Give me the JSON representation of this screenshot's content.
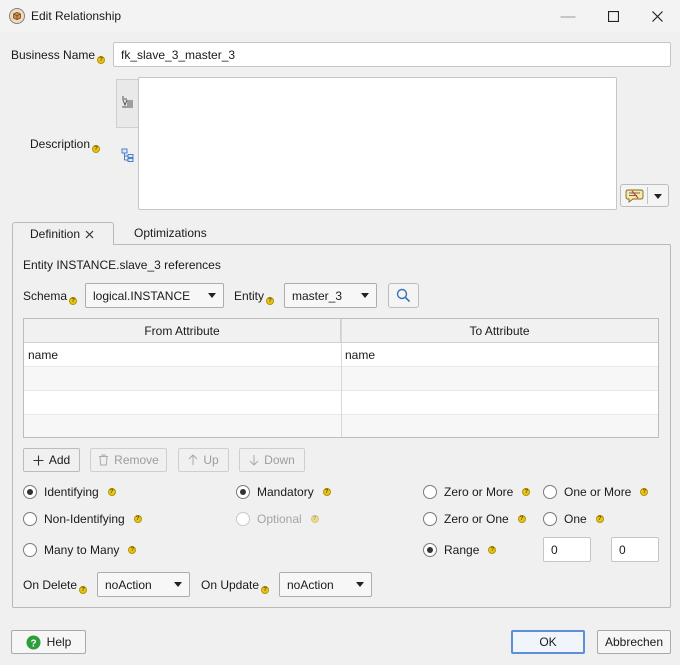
{
  "window": {
    "title": "Edit Relationship"
  },
  "business_name": {
    "label": "Business Name",
    "value": "fk_slave_3_master_3"
  },
  "description": {
    "label": "Description",
    "value": ""
  },
  "tabs": [
    {
      "label": "Definition"
    },
    {
      "label": "Optimizations"
    }
  ],
  "definition": {
    "reference_text": "Entity INSTANCE.slave_3 references",
    "schema_label": "Schema",
    "schema_value": "logical.INSTANCE",
    "entity_label": "Entity",
    "entity_value": "master_3",
    "columns": [
      "From Attribute",
      "To Attribute"
    ],
    "rows": [
      [
        "name",
        "name"
      ],
      [
        "",
        ""
      ],
      [
        "",
        ""
      ],
      [
        "",
        ""
      ]
    ],
    "buttons": {
      "add": "Add",
      "remove": "Remove",
      "up": "Up",
      "down": "Down"
    },
    "options": {
      "identifying": "Identifying",
      "non_identifying": "Non-Identifying",
      "many_to_many": "Many to Many",
      "mandatory": "Mandatory",
      "optional": "Optional",
      "zero_or_more": "Zero or More",
      "one_or_more": "One or More",
      "zero_or_one": "Zero or One",
      "one": "One",
      "range": "Range"
    },
    "selected": {
      "relationship": "Identifying",
      "requirement": "Mandatory",
      "cardinality": "Range"
    },
    "range_min": "0",
    "range_max": "0",
    "on_delete_label": "On Delete",
    "on_delete_value": "noAction",
    "on_update_label": "On Update",
    "on_update_value": "noAction"
  },
  "footer": {
    "help": "Help",
    "ok": "OK",
    "cancel": "Abbrechen"
  },
  "colors": {
    "accent": "#5c8fd6",
    "help_badge": "#e6c619",
    "help_button": "#2e9e3a"
  }
}
